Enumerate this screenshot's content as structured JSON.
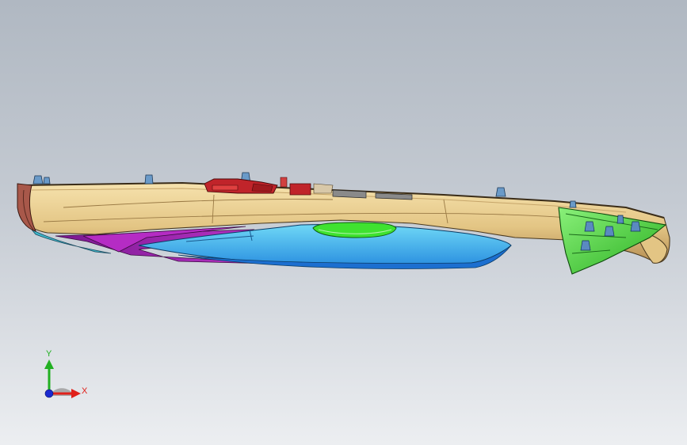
{
  "viewport": {
    "background_top": "#b0b8c2",
    "background_bottom": "#eceef1"
  },
  "model": {
    "colors": {
      "hull": "#e9cf93",
      "hull_shadow": "#b89356",
      "hull_edge": "#4a3a20",
      "stern_cap": "#a8584a",
      "cyan_panel": "#3fbfe6",
      "blue_panel": "#1e8fe0",
      "green_insert": "#3ee030",
      "magenta_panel": "#b020c0",
      "red_parts": "#c0242a",
      "bow_green": "#4ad63a",
      "fastener_blue": "#5a96c8"
    }
  },
  "triad": {
    "x_label": "X",
    "y_label": "Y",
    "x_color": "#e0201a",
    "y_color": "#22b022",
    "z_color": "#1a2ad0"
  }
}
